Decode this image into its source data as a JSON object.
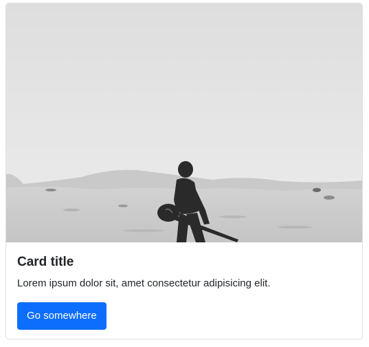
{
  "card": {
    "image_alt": "Person with guitar walking in desert",
    "title": "Card title",
    "text": "Lorem ipsum dolor sit, amet consectetur adipisicing elit.",
    "button_label": "Go somewhere"
  },
  "colors": {
    "primary": "#0d6efd",
    "border": "#dcdfe3",
    "text": "#212529"
  }
}
